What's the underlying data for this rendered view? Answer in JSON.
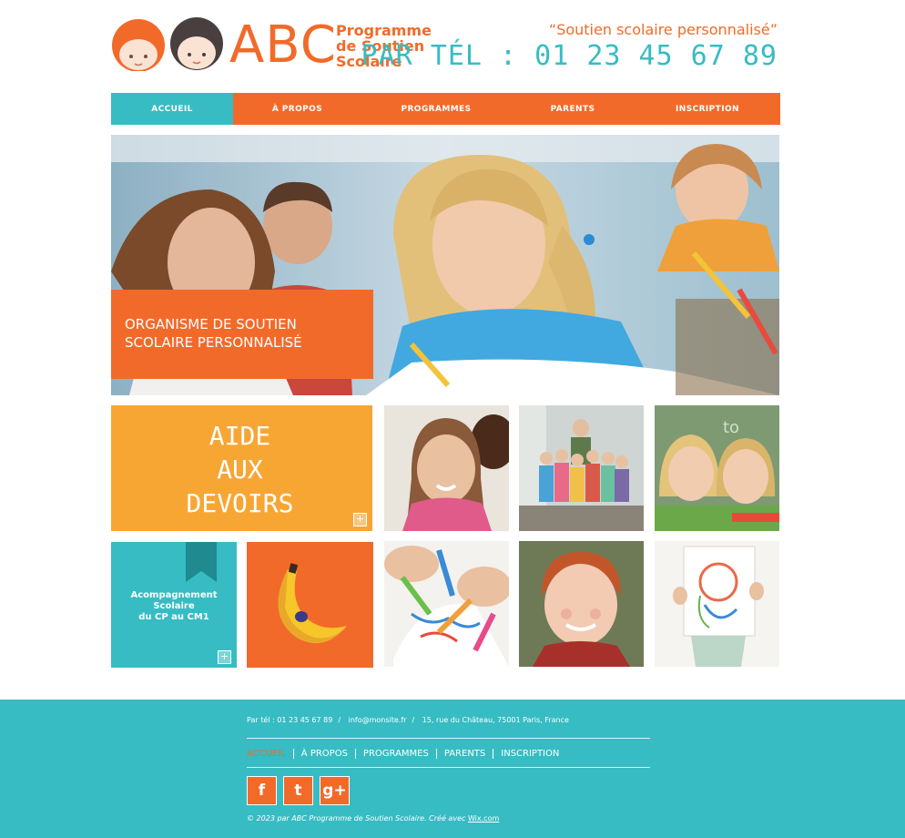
{
  "header": {
    "logo_abc": "ABC",
    "logo_sub": [
      "Programme",
      "de Soutien",
      "Scolaire"
    ],
    "tagline": "“Soutien scolaire personnalisé”",
    "phone": "PAR TÉL : 01 23 45 67 89"
  },
  "nav": {
    "items": [
      {
        "label": "ACCUEIL",
        "active": true
      },
      {
        "label": "À PROPOS",
        "active": false
      },
      {
        "label": "PROGRAMMES",
        "active": false
      },
      {
        "label": "PARENTS",
        "active": false
      },
      {
        "label": "INSCRIPTION",
        "active": false
      }
    ]
  },
  "hero": {
    "title_line1": "ORGANISME DE SOUTIEN",
    "title_line2": "SCOLAIRE PERSONNALISÉ"
  },
  "tiles": {
    "aide": [
      "AIDE",
      "AUX",
      "DEVOIRS"
    ],
    "aide_plus": "+",
    "acc": [
      "Acompagnement",
      "Scolaire",
      "du CP au CM1"
    ],
    "acc_plus": "+"
  },
  "footer": {
    "phone": "Par tél : 01 23 45 67 89",
    "sep": "/",
    "email": "info@monsite.fr",
    "address": "15, rue du Château, 75001 Paris, France",
    "nav": [
      "ACCUEIL",
      "À PROPOS",
      "PROGRAMMES",
      "PARENTS",
      "INSCRIPTION"
    ],
    "social": [
      {
        "icon": "facebook-icon",
        "glyph": "f"
      },
      {
        "icon": "twitter-icon",
        "glyph": "t"
      },
      {
        "icon": "google-plus-icon",
        "glyph": "g+"
      }
    ],
    "copyright": "© 2023 par ABC Programme de Soutien Scolaire. Créé avec",
    "wix": "Wix.com"
  },
  "colors": {
    "orange": "#f26a2a",
    "teal": "#37bcc3",
    "yellow": "#f7a634"
  }
}
